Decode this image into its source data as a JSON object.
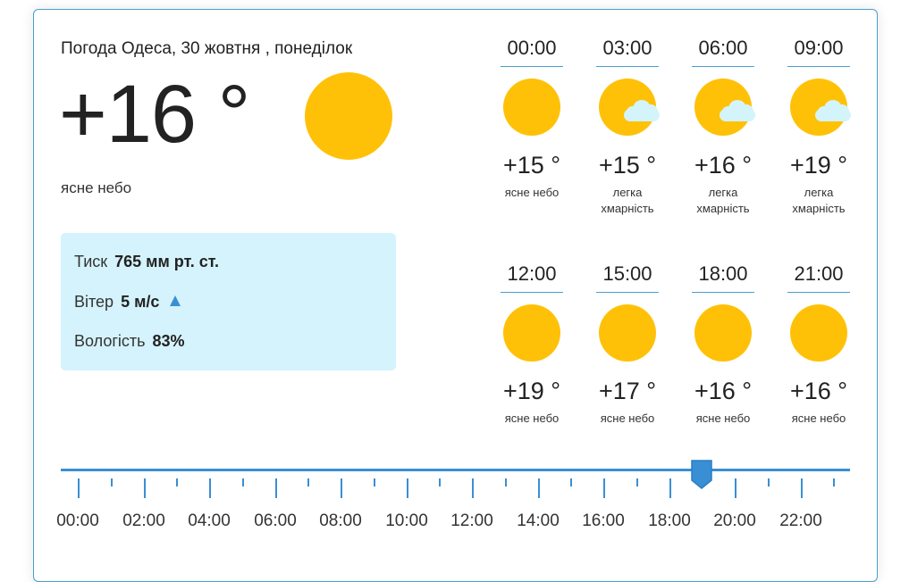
{
  "header": {
    "title": "Погода Одеса, 30 жовтня , понеділок"
  },
  "current": {
    "temperature": "+16 °",
    "condition": "ясне небо",
    "icon": "sun-icon"
  },
  "details": {
    "pressure_label": "Тиск",
    "pressure_value": "765 мм рт. ст.",
    "wind_label": "Вітер",
    "wind_value": "5 м/с",
    "wind_icon": "wind-direction-arrow-icon",
    "humidity_label": "Вологість",
    "humidity_value": "83%"
  },
  "hourly": [
    {
      "time": "00:00",
      "temp": "+15 °",
      "cond": "ясне небо",
      "icon": "sun-icon"
    },
    {
      "time": "03:00",
      "temp": "+15 °",
      "cond": "легка хмарність",
      "icon": "sun-cloud-icon"
    },
    {
      "time": "06:00",
      "temp": "+16 °",
      "cond": "легка хмарність",
      "icon": "sun-cloud-icon"
    },
    {
      "time": "09:00",
      "temp": "+19 °",
      "cond": "легка хмарність",
      "icon": "sun-cloud-icon"
    },
    {
      "time": "12:00",
      "temp": "+19 °",
      "cond": "ясне небо",
      "icon": "sun-icon"
    },
    {
      "time": "15:00",
      "temp": "+17 °",
      "cond": "ясне небо",
      "icon": "sun-icon"
    },
    {
      "time": "18:00",
      "temp": "+16 °",
      "cond": "ясне небо",
      "icon": "sun-icon"
    },
    {
      "time": "21:00",
      "temp": "+16 °",
      "cond": "ясне небо",
      "icon": "sun-icon"
    }
  ],
  "timeline": {
    "labels": [
      "00:00",
      "02:00",
      "04:00",
      "06:00",
      "08:00",
      "10:00",
      "12:00",
      "14:00",
      "16:00",
      "18:00",
      "20:00",
      "22:00"
    ],
    "selected_time": "19:00"
  },
  "colors": {
    "sun": "#FFC107",
    "cloud": "#d4f4fc",
    "accent": "#3a8fd4",
    "info_bg": "#d4f3fc"
  }
}
